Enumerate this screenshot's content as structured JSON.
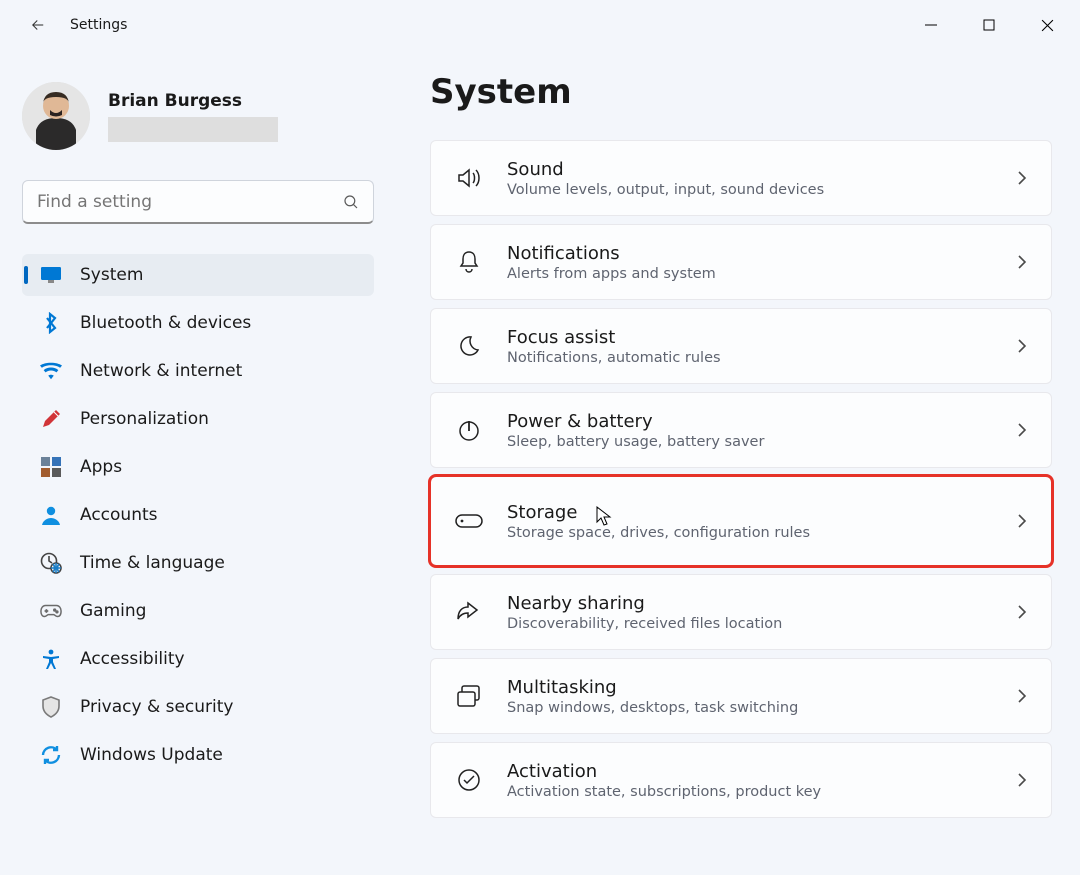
{
  "window": {
    "title": "Settings"
  },
  "profile": {
    "name": "Brian Burgess"
  },
  "search": {
    "placeholder": "Find a setting"
  },
  "sidebar": {
    "items": [
      {
        "label": "System",
        "icon": "monitor",
        "color": "#0078d4",
        "selected": true
      },
      {
        "label": "Bluetooth & devices",
        "icon": "bluetooth",
        "color": "#0078d4"
      },
      {
        "label": "Network & internet",
        "icon": "wifi",
        "color": "#0078d4"
      },
      {
        "label": "Personalization",
        "icon": "pencil",
        "color": "#d13438"
      },
      {
        "label": "Apps",
        "icon": "apps",
        "color": "#3a3a3a"
      },
      {
        "label": "Accounts",
        "icon": "person",
        "color": "#0f8fe0"
      },
      {
        "label": "Time & language",
        "icon": "clock-globe",
        "color": "#3a3a3a"
      },
      {
        "label": "Gaming",
        "icon": "gamepad",
        "color": "#8b8b8b"
      },
      {
        "label": "Accessibility",
        "icon": "accessibility",
        "color": "#0078d4"
      },
      {
        "label": "Privacy & security",
        "icon": "shield",
        "color": "#8b8b8b"
      },
      {
        "label": "Windows Update",
        "icon": "update",
        "color": "#0f8fe0"
      }
    ]
  },
  "main": {
    "title": "System",
    "cards": [
      {
        "title": "Sound",
        "desc": "Volume levels, output, input, sound devices",
        "icon": "sound"
      },
      {
        "title": "Notifications",
        "desc": "Alerts from apps and system",
        "icon": "bell"
      },
      {
        "title": "Focus assist",
        "desc": "Notifications, automatic rules",
        "icon": "moon"
      },
      {
        "title": "Power & battery",
        "desc": "Sleep, battery usage, battery saver",
        "icon": "power"
      },
      {
        "title": "Storage",
        "desc": "Storage space, drives, configuration rules",
        "icon": "storage",
        "highlighted": true,
        "cursor": true
      },
      {
        "title": "Nearby sharing",
        "desc": "Discoverability, received files location",
        "icon": "share"
      },
      {
        "title": "Multitasking",
        "desc": "Snap windows, desktops, task switching",
        "icon": "multitask"
      },
      {
        "title": "Activation",
        "desc": "Activation state, subscriptions, product key",
        "icon": "check-circle"
      }
    ]
  }
}
